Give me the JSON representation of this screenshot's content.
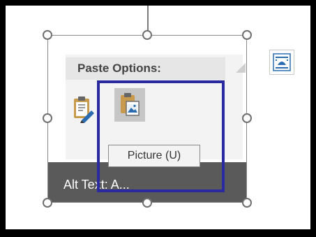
{
  "paste_options": {
    "header": "Paste Options:",
    "options": [
      {
        "icon": "paste-keep-formatting-icon",
        "selected": false
      },
      {
        "icon": "paste-picture-icon",
        "selected": true
      }
    ]
  },
  "tooltip": {
    "text": "Picture (U)"
  },
  "caption": {
    "alt_text": "Alt Text: A..."
  },
  "layout_options": {
    "icon": "layout-options-icon"
  },
  "colors": {
    "highlight": "#2a2aa0",
    "caption_bg": "#5a5a5a",
    "menu_bg": "#f3f3f3"
  }
}
